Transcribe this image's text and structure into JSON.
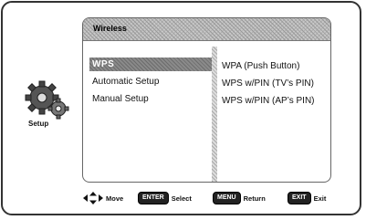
{
  "panel": {
    "title": "Wireless"
  },
  "side": {
    "icon": "gears-icon",
    "label": "Setup"
  },
  "menu": {
    "items": [
      {
        "label": "WPS",
        "selected": true
      },
      {
        "label": "Automatic Setup",
        "selected": false
      },
      {
        "label": "Manual Setup",
        "selected": false
      }
    ],
    "submenu": [
      {
        "label": "WPA (Push Button)"
      },
      {
        "label": "WPS w/PIN (TV’s PIN)"
      },
      {
        "label": "WPS w/PIN (AP’s PIN)"
      }
    ]
  },
  "footer": {
    "move": {
      "icon": "directional-arrows-icon",
      "label": "Move"
    },
    "select": {
      "key": "ENTER",
      "label": "Select"
    },
    "return": {
      "key": "MENU",
      "label": "Return"
    },
    "exit": {
      "key": "EXIT",
      "label": "Exit"
    }
  }
}
